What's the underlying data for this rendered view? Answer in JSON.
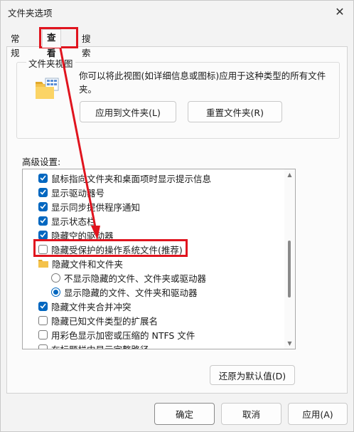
{
  "window": {
    "title": "文件夹选项",
    "close_glyph": "✕"
  },
  "tabs": [
    {
      "label": "常规"
    },
    {
      "label": "查看"
    },
    {
      "label": "搜索"
    }
  ],
  "folder_views": {
    "legend": "文件夹视图",
    "description": "你可以将此视图(如详细信息或图标)应用于这种类型的所有文件夹。",
    "apply_button": "应用到文件夹(L)",
    "reset_button": "重置文件夹(R)"
  },
  "advanced": {
    "label": "高级设置:",
    "items": [
      {
        "kind": "checkbox",
        "checked": true,
        "label": "鼠标指向文件夹和桌面项时显示提示信息"
      },
      {
        "kind": "checkbox",
        "checked": true,
        "label": "显示驱动器号"
      },
      {
        "kind": "checkbox",
        "checked": true,
        "label": "显示同步提供程序通知"
      },
      {
        "kind": "checkbox",
        "checked": true,
        "label": "显示状态栏"
      },
      {
        "kind": "checkbox",
        "checked": true,
        "label": "隐藏空的驱动器"
      },
      {
        "kind": "checkbox",
        "checked": false,
        "label": "隐藏受保护的操作系统文件(推荐)"
      },
      {
        "kind": "folder",
        "label": "隐藏文件和文件夹"
      },
      {
        "kind": "radio",
        "checked": false,
        "label": "不显示隐藏的文件、文件夹或驱动器"
      },
      {
        "kind": "radio",
        "checked": true,
        "label": "显示隐藏的文件、文件夹和驱动器"
      },
      {
        "kind": "checkbox",
        "checked": true,
        "label": "隐藏文件夹合并冲突"
      },
      {
        "kind": "checkbox",
        "checked": false,
        "label": "隐藏已知文件类型的扩展名"
      },
      {
        "kind": "checkbox",
        "checked": false,
        "label": "用彩色显示加密或压缩的 NTFS 文件"
      },
      {
        "kind": "checkbox",
        "checked": false,
        "label": "在标题栏中显示完整路径"
      }
    ],
    "restore_button": "还原为默认值(D)"
  },
  "footer": {
    "ok": "确定",
    "cancel": "取消",
    "apply": "应用(A)"
  },
  "colors": {
    "accent": "#0067c0",
    "highlight": "#e0141e"
  }
}
